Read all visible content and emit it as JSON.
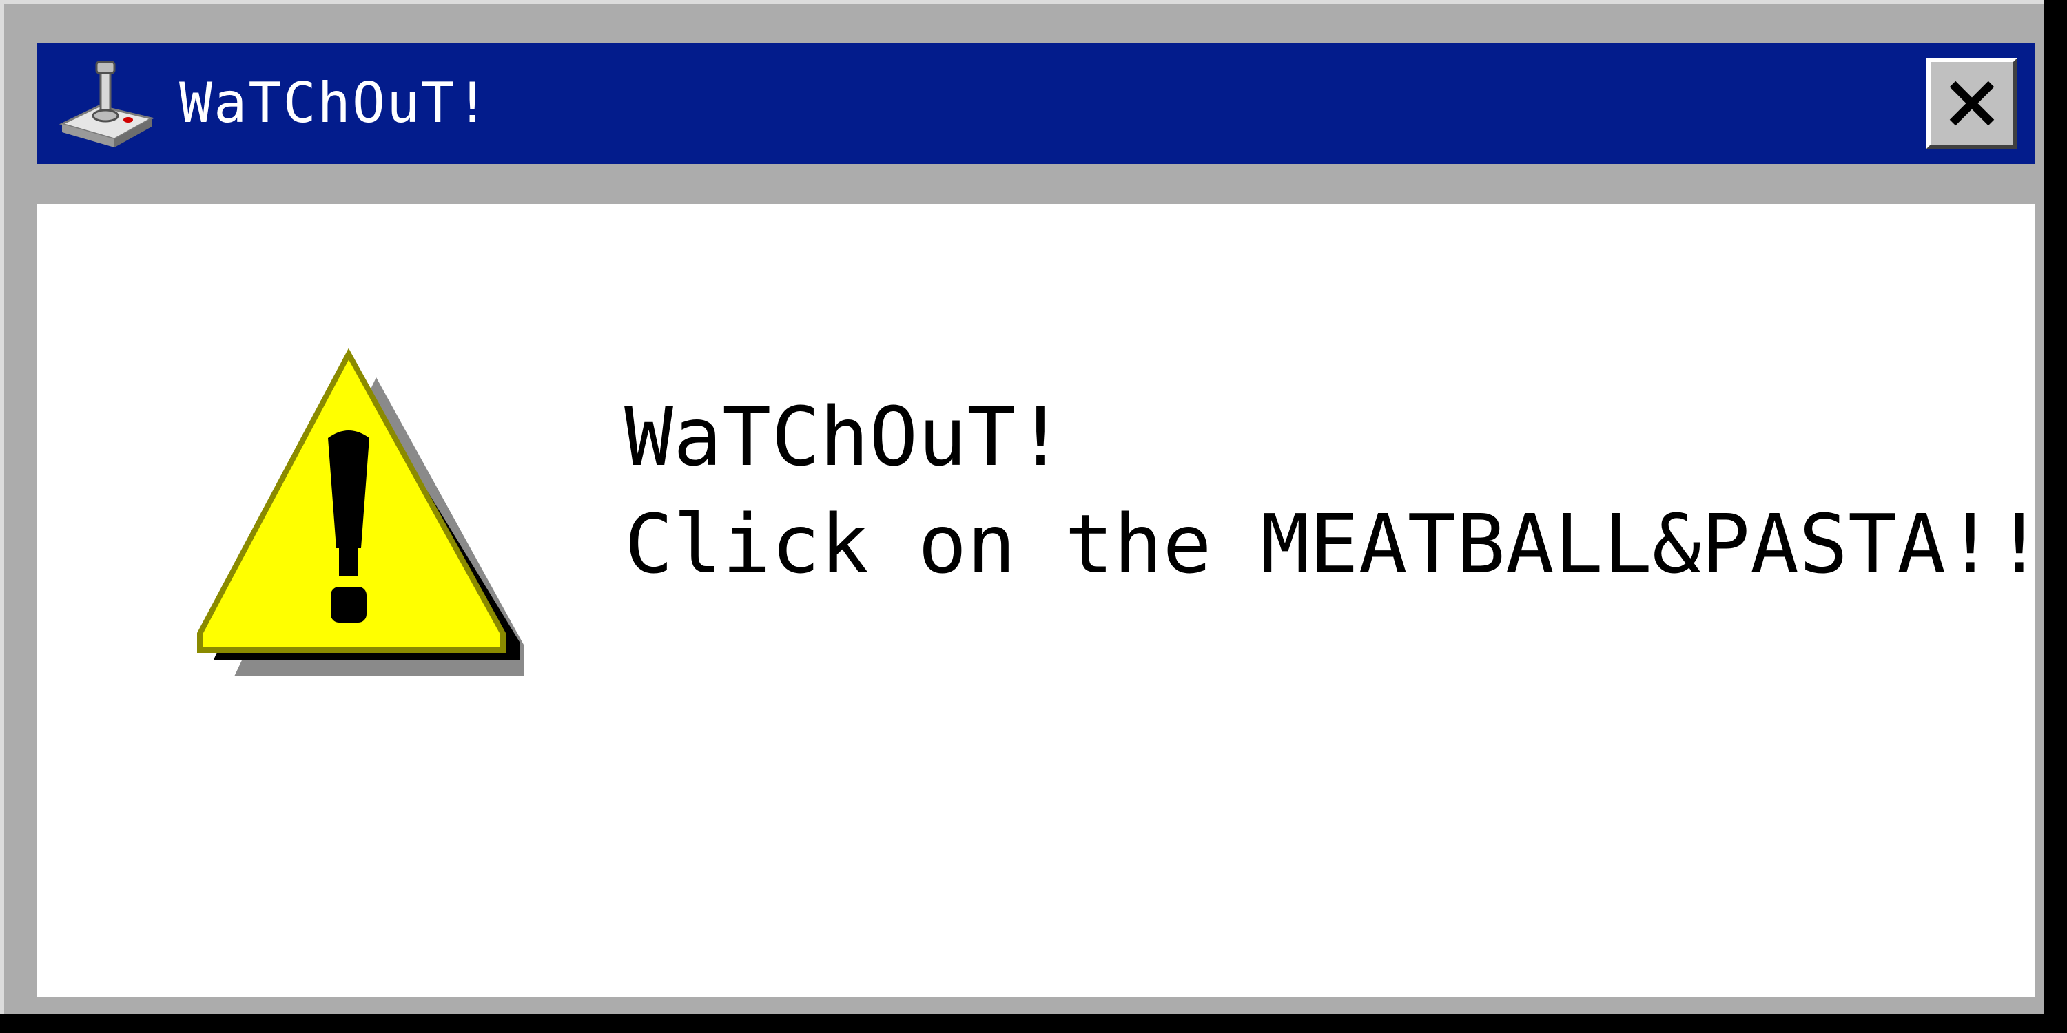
{
  "window": {
    "title": "WaTChOuT!",
    "title_icon": "joystick-icon",
    "close_icon": "close-icon",
    "colors": {
      "titlebar": "#031c8c",
      "frame": "#acacac",
      "content_bg": "#ffffff",
      "title_text": "#ffffff"
    }
  },
  "message": {
    "icon": "warning-icon",
    "line1": "WaTChOuT!",
    "line2": "Click on the MEATBALL&PASTA!!",
    "icon_color": "#ffff00"
  }
}
